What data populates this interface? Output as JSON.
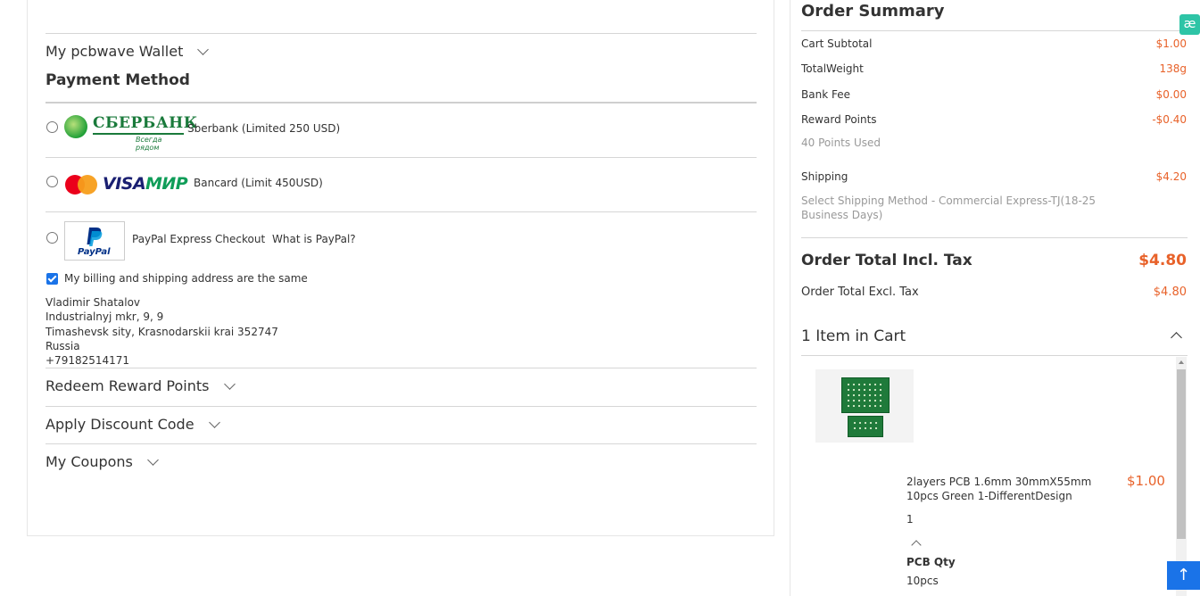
{
  "checkout": {
    "wallet_label": "My pcbwave Wallet",
    "payment_method_title": "Payment Method",
    "methods": [
      {
        "label": "Sberbank (Limited 250 USD)",
        "logo_text": "СБЕРБАНК",
        "logo_sub": "Всегда рядом",
        "selected": false
      },
      {
        "label": "Bancard (Limit 450USD)",
        "logo_visa": "VISA",
        "logo_mir": "МИР",
        "selected": false
      },
      {
        "label": "PayPal Express Checkout",
        "link": "What is PayPal?",
        "logo_text": "PayPal",
        "selected": false
      }
    ],
    "same_address_label": "My billing and shipping address are the same",
    "same_address_checked": true,
    "address": {
      "name": "Vladimir Shatalov",
      "street": "Industrialnyj mkr, 9, 9",
      "city_line": "Timashevsk sity, Krasnodarskii krai 352747",
      "country": "Russia",
      "phone": "+79182514171"
    },
    "redeem_label": "Redeem Reward Points",
    "discount_label": "Apply Discount Code",
    "coupons_label": "My Coupons"
  },
  "summary": {
    "title": "Order Summary",
    "subtotal_label": "Cart Subtotal",
    "subtotal_value": "$1.00",
    "weight_label": "TotalWeight",
    "weight_value": "138g",
    "bank_fee_label": "Bank Fee",
    "bank_fee_value": "$0.00",
    "reward_label": "Reward Points",
    "reward_value": "-$0.40",
    "points_used": "40 Points Used",
    "shipping_label": "Shipping",
    "shipping_value": "$4.20",
    "shipping_method": "Select Shipping Method - Commercial Express-TJ(18-25 Business Days)",
    "total_incl_label": "Order Total Incl. Tax",
    "total_incl_value": "$4.80",
    "total_excl_label": "Order Total Excl. Tax",
    "total_excl_value": "$4.80",
    "cart_title": "1 Item in Cart",
    "item": {
      "name": "2layers PCB 1.6mm 30mmX55mm 10pcs Green 1-DifferentDesign",
      "price": "$1.00",
      "qty": "1",
      "option_label": "PCB Qty",
      "option_value": "10pcs"
    }
  },
  "colors": {
    "accent": "#e8622a",
    "primary": "#1a73e8",
    "divider": "#d6d6d6"
  },
  "widgets": {
    "ext_icon_text": "æ",
    "to_top_text": "↑"
  }
}
